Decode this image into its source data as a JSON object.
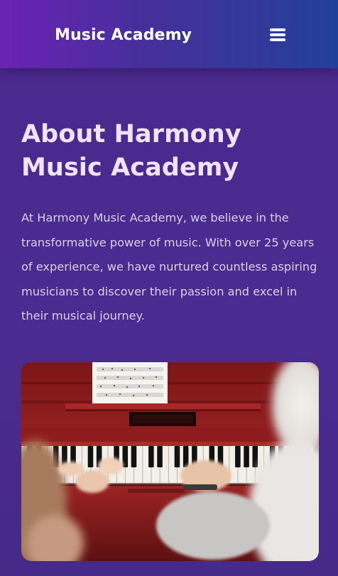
{
  "header": {
    "brand": "Music Academy",
    "menu_icon": "hamburger-menu-icon"
  },
  "about": {
    "title": "About Harmony Music Academy",
    "description": "At Harmony Music Academy, we believe in the transformative power of music. With over 25 years of experience, we have nurtured countless aspiring musicians to discover their passion and excel in their musical journey."
  },
  "image": {
    "alt": "Child and teacher playing a red piano with sheet music"
  },
  "colors": {
    "page_background": "#4a2a8f",
    "header_gradient_start": "#6a22b4",
    "header_gradient_end": "#22409a",
    "heading_text": "#efe3ff",
    "body_text": "#dacfee",
    "piano_red": "#8e1c1c"
  }
}
